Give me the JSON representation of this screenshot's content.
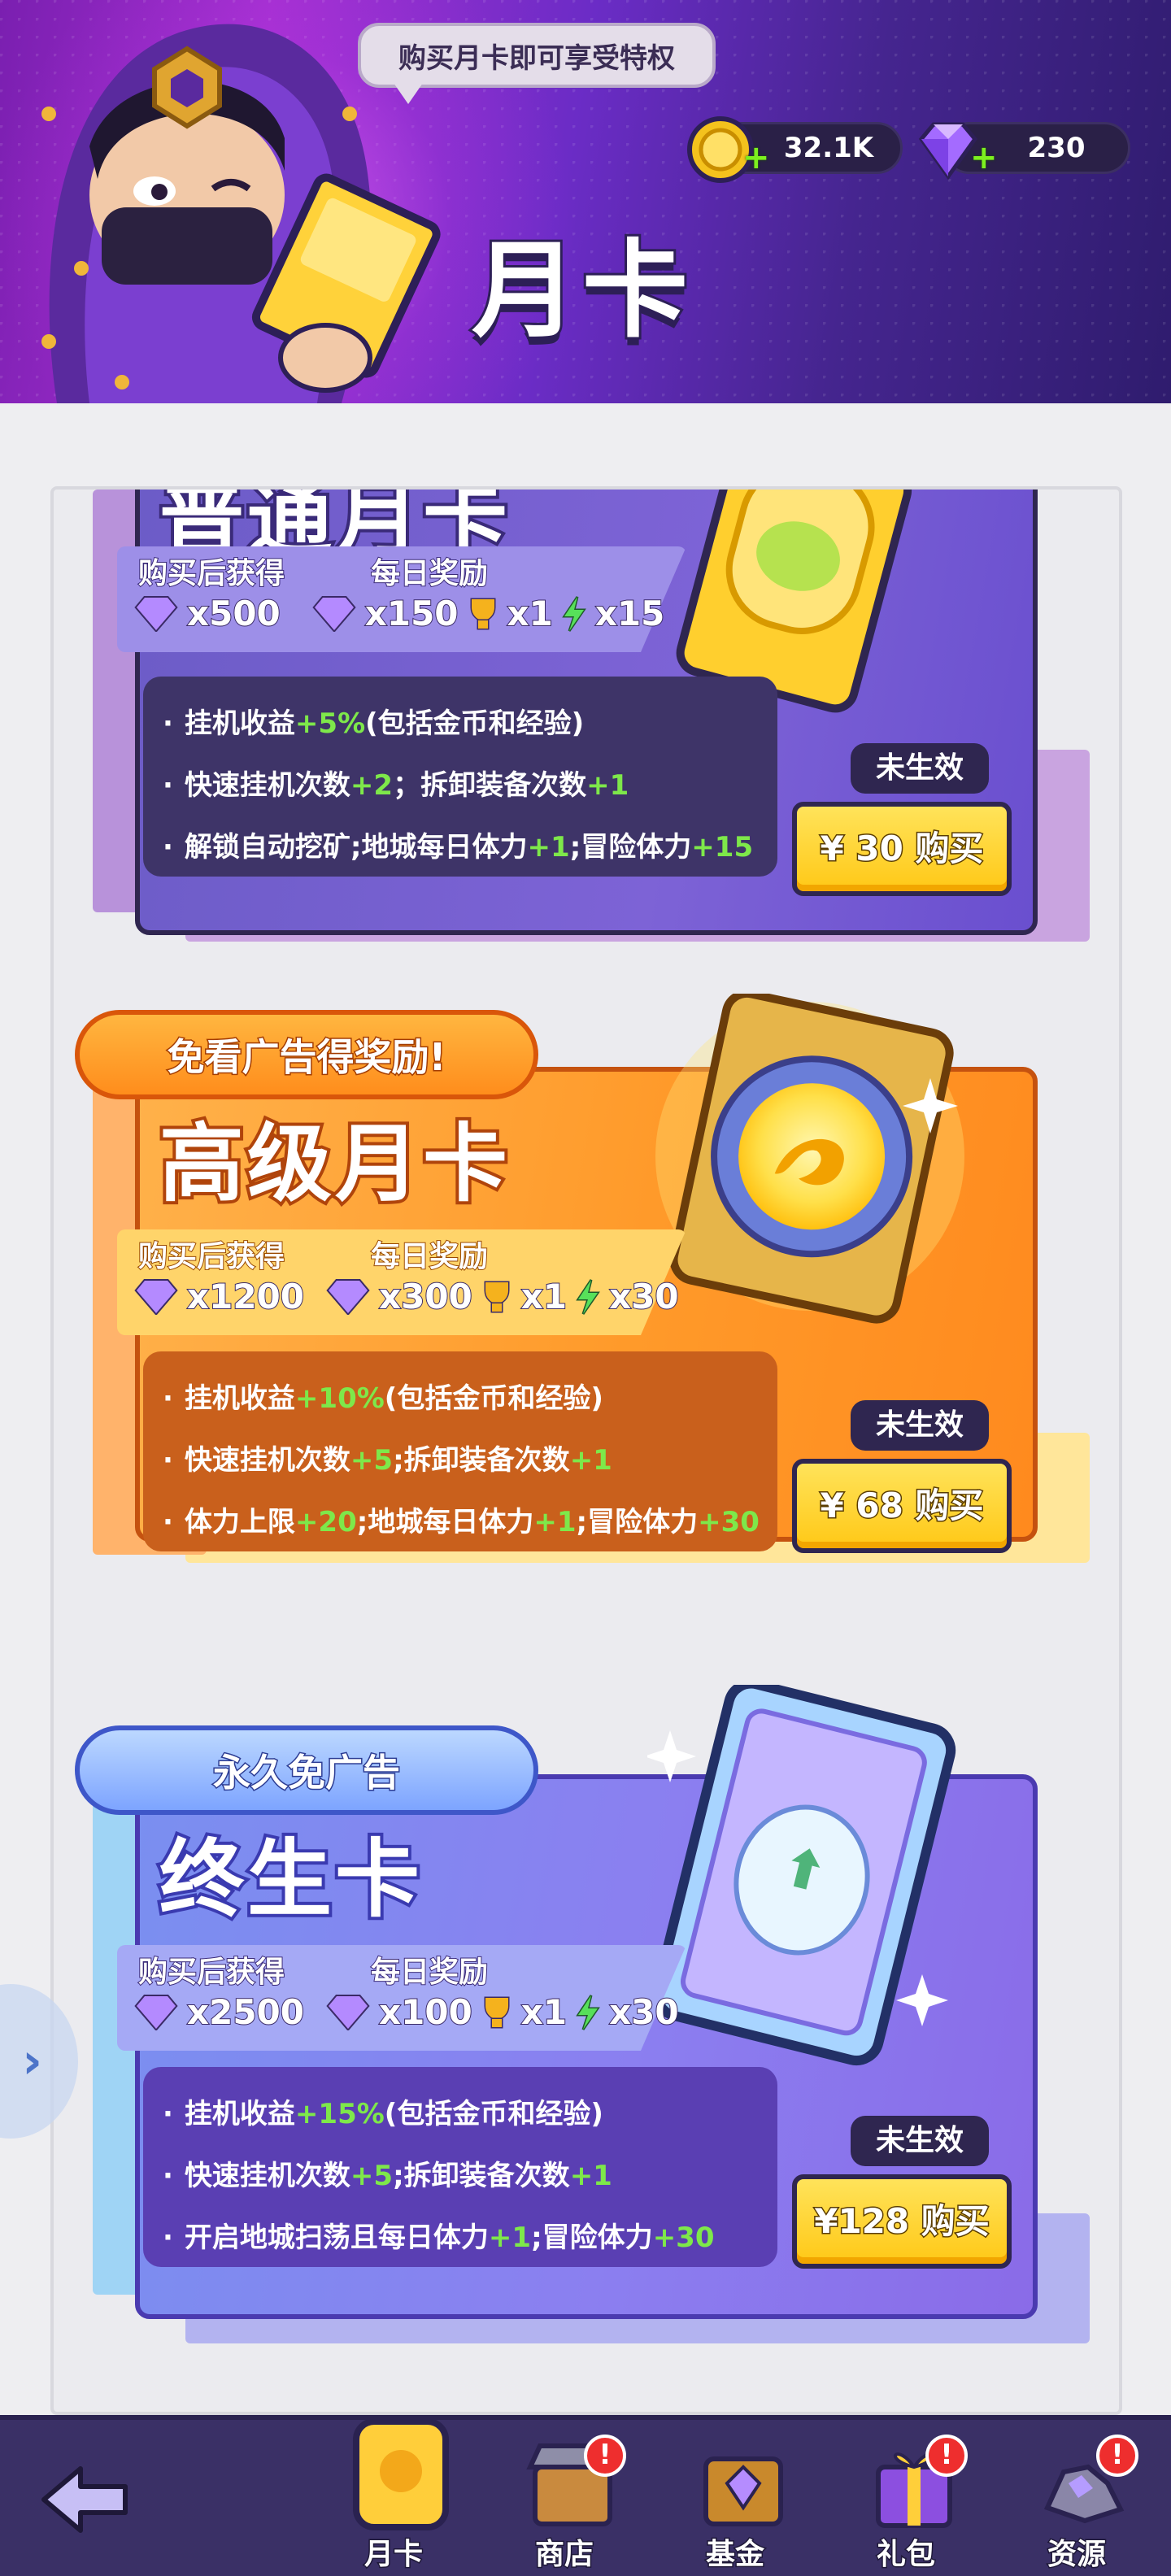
{
  "header": {
    "speech": "购买月卡即可享受特权",
    "title": "月卡",
    "coins": "32.1K",
    "gems": "230"
  },
  "cards": [
    {
      "name": "普通月卡",
      "label_buy": "购买后获得",
      "label_daily": "每日奖励",
      "buy_reward": "x500",
      "daily_gems": "x150",
      "daily_cup": "x1",
      "daily_energy": "x15",
      "perks": [
        {
          "pre": "挂机收益",
          "val": "+5%",
          "post": "(包括金币和经验)"
        },
        {
          "pre": "快速挂机次数",
          "val": "+2",
          "post": "；拆卸装备次数",
          "val2": "+1"
        },
        {
          "pre": "解锁自动挖矿;地城每日体力",
          "val": "+1",
          "post": ";冒险体力",
          "val2": "+15"
        }
      ],
      "status": "未生效",
      "price": "¥ 30 购买"
    },
    {
      "banner": "免看广告得奖励!",
      "name": "高级月卡",
      "label_buy": "购买后获得",
      "label_daily": "每日奖励",
      "buy_reward": "x1200",
      "daily_gems": "x300",
      "daily_cup": "x1",
      "daily_energy": "x30",
      "perks": [
        {
          "pre": "挂机收益",
          "val": "+10%",
          "post": "(包括金币和经验)"
        },
        {
          "pre": "快速挂机次数",
          "val": "+5",
          "post": ";拆卸装备次数",
          "val2": "+1"
        },
        {
          "pre": "体力上限",
          "val": "+20",
          "post": ";地城每日体力",
          "val2": "+1",
          "post2": ";冒险体力",
          "val3": "+30"
        }
      ],
      "status": "未生效",
      "price": "¥ 68 购买"
    },
    {
      "banner": "永久免广告",
      "name": "终生卡",
      "label_buy": "购买后获得",
      "label_daily": "每日奖励",
      "buy_reward": "x2500",
      "daily_gems": "x100",
      "daily_cup": "x1",
      "daily_energy": "x30",
      "perks": [
        {
          "pre": "挂机收益",
          "val": "+15%",
          "post": "(包括金币和经验)"
        },
        {
          "pre": "快速挂机次数",
          "val": "+5",
          "post": ";拆卸装备次数",
          "val2": "+1"
        },
        {
          "pre": "开启地城扫荡且每日体力",
          "val": "+1",
          "post": ";冒险体力",
          "val2": "+30"
        }
      ],
      "status": "未生效",
      "price": "¥128 购买"
    }
  ],
  "nav": {
    "items": [
      {
        "label": "月卡",
        "badge": ""
      },
      {
        "label": "商店",
        "badge": "!"
      },
      {
        "label": "基金",
        "badge": ""
      },
      {
        "label": "礼包",
        "badge": "!"
      },
      {
        "label": "资源",
        "badge": "!"
      }
    ]
  },
  "colors": {
    "green_value": "#7ee84a",
    "button_yellow": "#ffc816",
    "nav_bg": "#3a3066"
  }
}
